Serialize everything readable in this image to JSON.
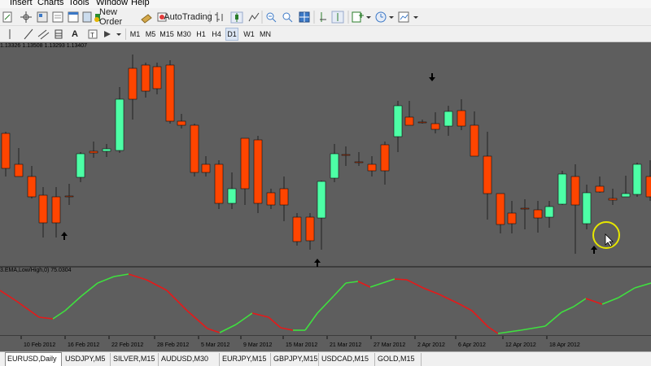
{
  "menubar": {
    "items": [
      {
        "label": "Insert"
      },
      {
        "label": "Charts"
      },
      {
        "label": "Tools"
      },
      {
        "label": "Window"
      },
      {
        "label": "Help"
      }
    ]
  },
  "toolbar": {
    "new_order_label": "New Order",
    "autotrading_label": "AutoTrading",
    "text_tool_label": "A",
    "timeframes": [
      {
        "label": "M1",
        "active": false
      },
      {
        "label": "M5",
        "active": false
      },
      {
        "label": "M15",
        "active": false
      },
      {
        "label": "M30",
        "active": false
      },
      {
        "label": "H1",
        "active": false
      },
      {
        "label": "H4",
        "active": false
      },
      {
        "label": "D1",
        "active": true
      },
      {
        "label": "W1",
        "active": false
      },
      {
        "label": "MN",
        "active": false
      }
    ]
  },
  "chart": {
    "ohlc_text": "1.13326 1.13508 1.13293 1.13407",
    "indicator_text": "3.EMA,Low/High,0) 75.0304",
    "x_tick_labels": [
      "10 Feb 2012",
      "16 Feb 2012",
      "22 Feb 2012",
      "28 Feb 2012",
      "5 Mar 2012",
      "9 Mar 2012",
      "15 Mar 2012",
      "21 Mar 2012",
      "27 Mar 2012",
      "2 Apr 2012",
      "6 Apr 2012",
      "12 Apr 2012",
      "18 Apr 2012"
    ],
    "bull_color": "#4dffa6",
    "bear_color": "#ff4500",
    "up_arrows": 3,
    "down_arrows": 1
  },
  "chart_data": {
    "type": "candlestick",
    "panes": [
      "price",
      "oscillator"
    ],
    "x_labels": [
      "10 Feb 2012",
      "16 Feb 2012",
      "22 Feb 2012",
      "28 Feb 2012",
      "5 Mar 2012",
      "9 Mar 2012",
      "15 Mar 2012",
      "21 Mar 2012",
      "27 Mar 2012",
      "2 Apr 2012",
      "6 Apr 2012",
      "12 Apr 2012",
      "18 Apr 2012"
    ],
    "last_bar_ohlc": {
      "open": 1.13326,
      "high": 1.13508,
      "low": 1.13293,
      "close": 1.13407
    },
    "indicator_value": 75.0304
  },
  "tabs": [
    {
      "label": "EURUSD,Daily",
      "active": true
    },
    {
      "label": "USDJPY,M5",
      "active": false
    },
    {
      "label": "SILVER,M15",
      "active": false
    },
    {
      "label": "AUDUSD,M30",
      "active": false
    },
    {
      "label": "EURJPY,M15",
      "active": false
    },
    {
      "label": "GBPJPY,M15",
      "active": false
    },
    {
      "label": "USDCAD,M15",
      "active": false
    },
    {
      "label": "GOLD,M15",
      "active": false
    }
  ]
}
